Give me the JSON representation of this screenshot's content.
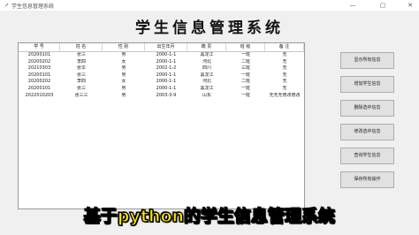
{
  "window": {
    "title": "学生信息管理系统",
    "controls": [
      "—",
      "▢",
      "✕"
    ]
  },
  "heading": "学生信息管理系统",
  "table": {
    "columns": [
      "学 号",
      "姓 名",
      "性 别",
      "出生年月",
      "籍 贯",
      "班 级",
      "备 注"
    ],
    "rows": [
      [
        "20200101",
        "张三",
        "男",
        "2000-1-1",
        "黑龙江",
        "一班",
        "无"
      ],
      [
        "20200202",
        "李四",
        "女",
        "2000-1-1",
        "河北",
        "二班",
        "无"
      ],
      [
        "20210303",
        "张伞",
        "男",
        "2002-1-2",
        "四川",
        "三班",
        "无"
      ],
      [
        "20200101",
        "张三",
        "男",
        "2000-1-1",
        "黑龙江",
        "一班",
        "无"
      ],
      [
        "20200202",
        "李四",
        "女",
        "2000-1-1",
        "河北",
        "二班",
        "无"
      ],
      [
        "20200101",
        "张三",
        "男",
        "2000-1-1",
        "黑龙江",
        "一班",
        "无"
      ],
      [
        "2022010203",
        "张三三",
        "男",
        "2003-3-9",
        "山东",
        "一班",
        "无无无修改修改"
      ]
    ]
  },
  "buttons": [
    "显示所有信息",
    "增加学生信息",
    "删除选中信息",
    "修改选中信息",
    "查询学生信息",
    "保存所有操作"
  ],
  "caption": "基于python的学生信息管理系统"
}
